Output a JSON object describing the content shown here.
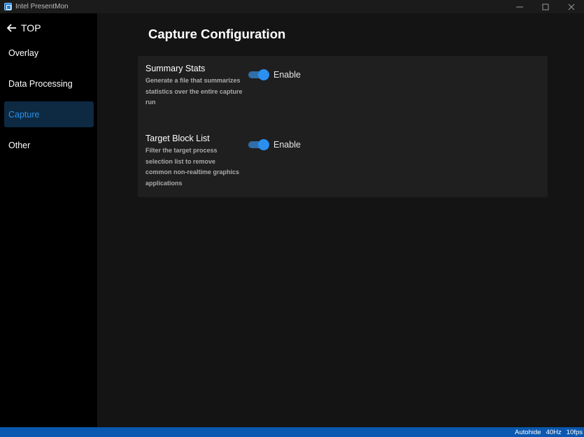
{
  "window": {
    "title": "Intel PresentMon",
    "icon": "presentmon-app-icon"
  },
  "sidebar": {
    "back_label": "TOP",
    "items": [
      {
        "label": "Overlay",
        "active": false
      },
      {
        "label": "Data Processing",
        "active": false
      },
      {
        "label": "Capture",
        "active": true
      },
      {
        "label": "Other",
        "active": false
      }
    ]
  },
  "main": {
    "title": "Capture Configuration",
    "settings": [
      {
        "title": "Summary Stats",
        "description": "Generate a file that summarizes statistics over the entire capture run",
        "toggle_label": "Enable",
        "enabled": true
      },
      {
        "title": "Target Block List",
        "description": "Filter the target process selection list to remove common non-realtime graphics applications",
        "toggle_label": "Enable",
        "enabled": true
      }
    ]
  },
  "statusbar": {
    "autohide": "Autohide",
    "refresh": "40Hz",
    "fps": "10fps"
  },
  "colors": {
    "accent": "#2b8ff0",
    "sidebar_active_bg": "#0d2a42",
    "statusbar_bg": "#0a58b0",
    "card_bg": "#1f1f1f"
  }
}
